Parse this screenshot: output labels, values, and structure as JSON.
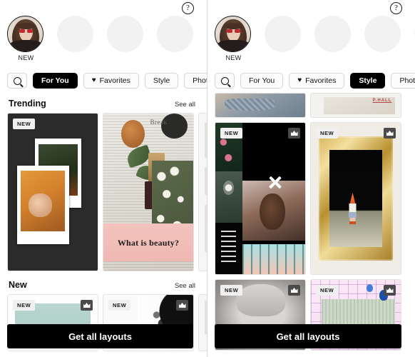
{
  "panels": [
    {
      "help_icon": "?",
      "story": {
        "label": "NEW",
        "avatar_alt": "user-avatar"
      },
      "filters": {
        "search_icon": "search-icon",
        "items": [
          {
            "label": "For You",
            "active": true,
            "icon": null
          },
          {
            "label": "Favorites",
            "active": false,
            "icon": "heart-icon"
          },
          {
            "label": "Style",
            "active": false,
            "icon": null
          },
          {
            "label": "Photogra",
            "active": false,
            "icon": null
          }
        ]
      },
      "sections": [
        {
          "title": "Trending",
          "see_all": "See all",
          "cards": [
            {
              "badge": "NEW",
              "crown": false,
              "caption": null
            },
            {
              "badge": null,
              "crown": false,
              "caption": "What is beauty?",
              "top_word": "Break"
            },
            {
              "badge": null,
              "crown": false,
              "caption": null
            }
          ]
        },
        {
          "title": "New",
          "see_all": "See all",
          "cards": [
            {
              "badge": "NEW",
              "crown": true,
              "caption": null
            },
            {
              "badge": "NEW",
              "crown": true,
              "caption": null
            },
            {
              "badge": null,
              "crown": false,
              "caption": null
            }
          ]
        }
      ],
      "cta": "Get all layouts"
    },
    {
      "help_icon": "?",
      "story": {
        "label": "NEW",
        "avatar_alt": "user-avatar"
      },
      "filters": {
        "search_icon": "search-icon",
        "items": [
          {
            "label": "For You",
            "active": false,
            "icon": null
          },
          {
            "label": "Favorites",
            "active": false,
            "icon": "heart-icon"
          },
          {
            "label": "Style",
            "active": true,
            "icon": null
          },
          {
            "label": "Photogr",
            "active": false,
            "icon": null
          }
        ]
      },
      "grid": {
        "rows": [
          [
            {
              "badge": null,
              "crown": false
            },
            {
              "badge": null,
              "crown": false,
              "label": "P.HALL"
            }
          ],
          [
            {
              "badge": "NEW",
              "crown": true
            },
            {
              "badge": "NEW",
              "crown": true
            }
          ],
          [
            {
              "badge": "NEW",
              "crown": true
            },
            {
              "badge": "NEW",
              "crown": true
            }
          ]
        ]
      },
      "cta": "Get all layouts"
    }
  ],
  "colors": {
    "accent_black": "#000000",
    "badge_bg": "#f0f0f0",
    "crown_bg": "#4a4a4a",
    "panel_bg": "#ffffff",
    "page_bg": "#e9e9ea",
    "pill_border": "#d4d4d4"
  }
}
